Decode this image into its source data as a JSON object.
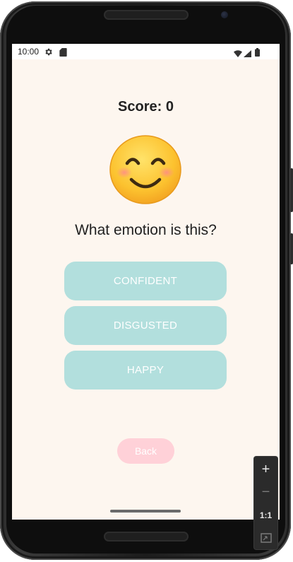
{
  "status_bar": {
    "time": "10:00"
  },
  "game": {
    "score_text": "Score: 0",
    "emoji": "smiling-face-with-smiling-eyes",
    "question": "What emotion is this?",
    "answers": [
      "CONFIDENT",
      "DISGUSTED",
      "HAPPY"
    ],
    "back_label": "Back"
  },
  "emulator_toolbar": {
    "zoom_in": "+",
    "zoom_out": "−",
    "actual_size": "1:1"
  },
  "colors": {
    "background": "#fdf6ef",
    "answer_button": "#b2dfdd",
    "back_button": "#ffd1d8",
    "text": "#222222"
  },
  "icons": {
    "status": [
      "settings-gear-icon",
      "sd-card-icon",
      "wifi-icon",
      "cellular-signal-icon",
      "battery-icon"
    ],
    "toolbar": [
      "zoom-in-icon",
      "zoom-out-icon",
      "fit-screen-icon"
    ]
  }
}
